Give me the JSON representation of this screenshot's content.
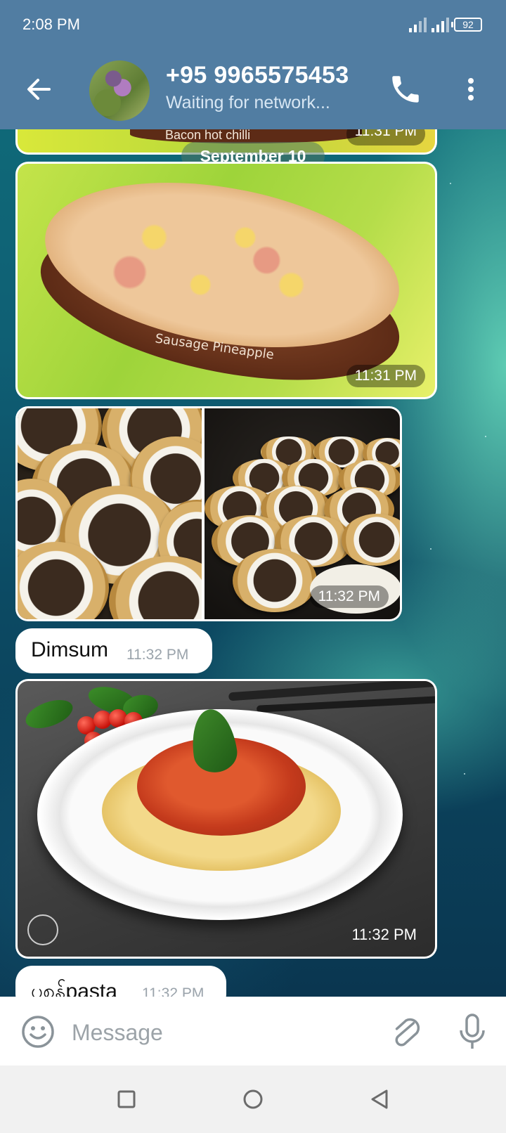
{
  "status_bar": {
    "time": "2:08 PM",
    "battery": "92"
  },
  "header": {
    "contact_name": "+95 9965575453",
    "contact_status": "Waiting for network..."
  },
  "chat": {
    "date_separator": "September 10",
    "messages": [
      {
        "type": "photo",
        "caption_in_image": "Bacon hot chilli",
        "time": "11:31 PM"
      },
      {
        "type": "photo",
        "caption_in_image": "Sausage Pineapple",
        "time": "11:31 PM"
      },
      {
        "type": "photo_album",
        "count": 2,
        "time": "11:32 PM"
      },
      {
        "type": "text",
        "text": "Dimsum",
        "time": "11:32 PM"
      },
      {
        "type": "photo",
        "time": "11:32 PM"
      },
      {
        "type": "text",
        "text": "ပုစွန်pasta",
        "time": "11:32 PM"
      }
    ]
  },
  "composer": {
    "placeholder": "Message"
  },
  "icons": {
    "back": "arrow-left",
    "call": "phone",
    "menu": "dots-vertical",
    "emoji": "smiley",
    "attach": "paperclip",
    "mic": "microphone",
    "nav_recents": "square",
    "nav_home": "circle",
    "nav_back": "triangle-left"
  },
  "colors": {
    "header": "#517da2",
    "bubble": "#ffffff",
    "nav_bar": "#f1f1f1"
  }
}
